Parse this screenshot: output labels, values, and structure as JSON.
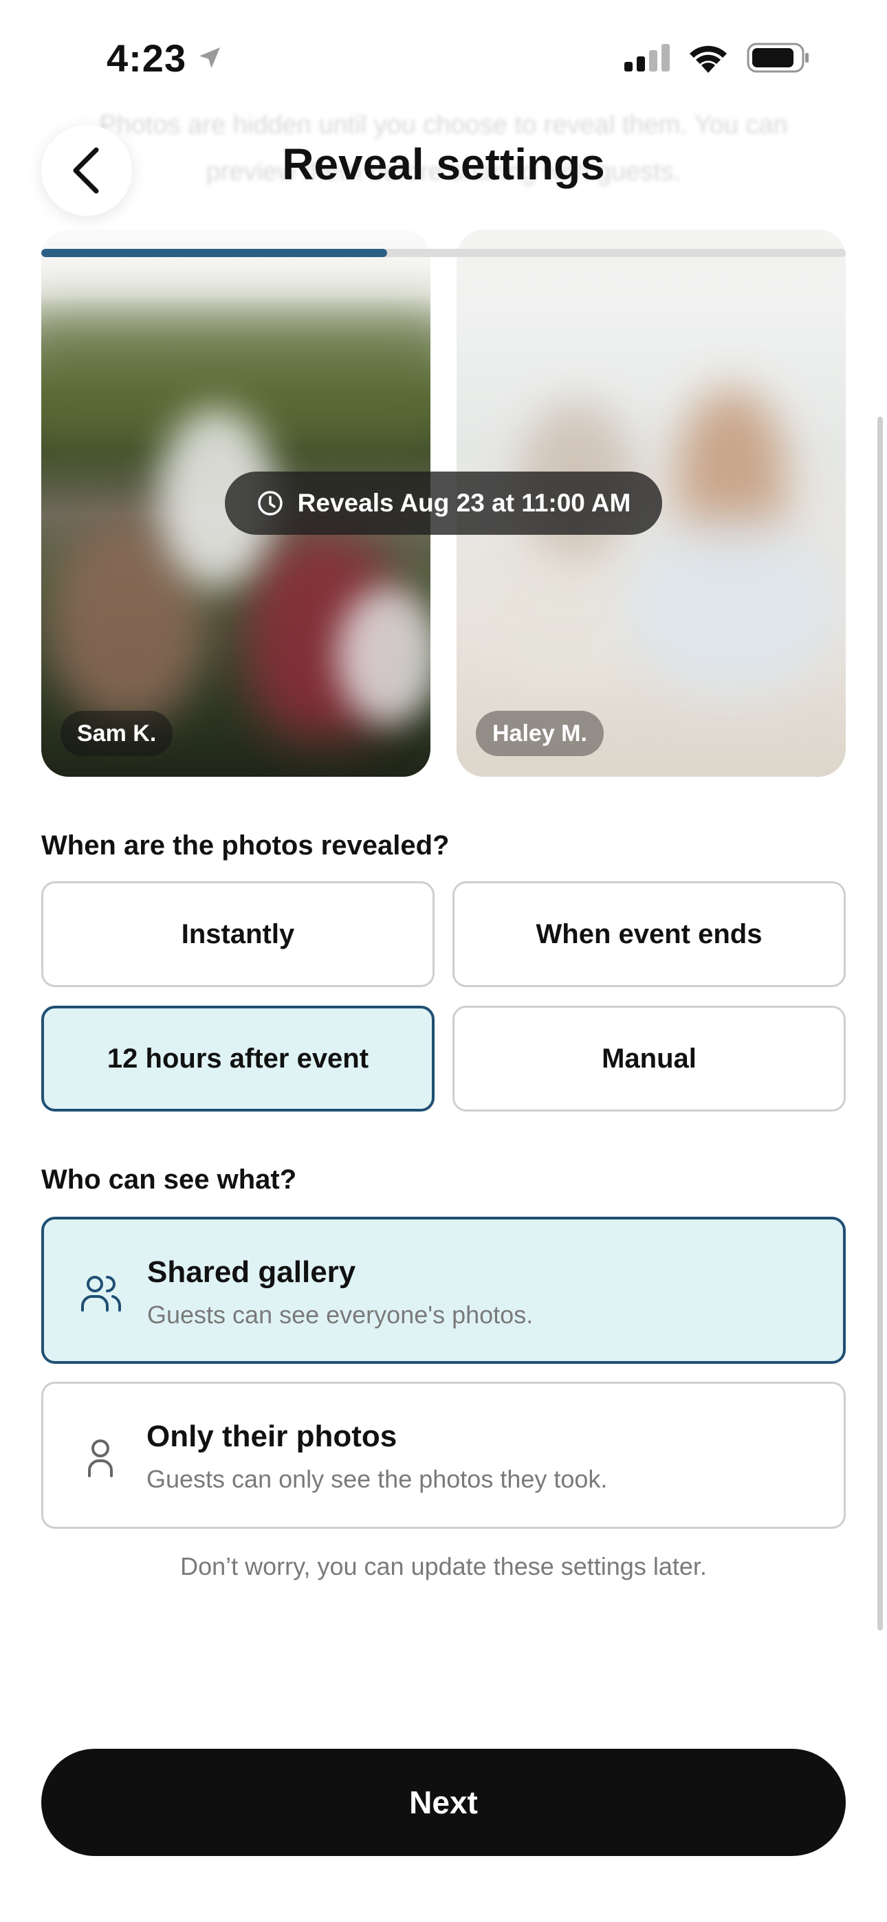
{
  "status_bar": {
    "time": "4:23"
  },
  "background_text": "Photos are hidden until you choose to reveal them. You can preview them before sharing with guests.",
  "header": {
    "title": "Reveal settings"
  },
  "progress": {
    "fraction": 0.43
  },
  "photos": [
    {
      "name": "Sam K."
    },
    {
      "name": "Haley M."
    }
  ],
  "reveal_badge": "Reveals Aug 23 at 11:00 AM",
  "reveal_section": {
    "heading": "When are the photos revealed?",
    "options": [
      "Instantly",
      "When event ends",
      "12 hours after event",
      "Manual"
    ],
    "selected": "12 hours after event"
  },
  "visibility_section": {
    "heading": "Who can see what?",
    "options": [
      {
        "title": "Shared gallery",
        "description": "Guests can see everyone's photos.",
        "icon": "users-icon"
      },
      {
        "title": "Only their photos",
        "description": "Guests can only see the photos they took.",
        "icon": "user-icon"
      }
    ],
    "selected": "Shared gallery"
  },
  "footnote": "Don’t worry, you can update these settings later.",
  "next_button": "Next",
  "colors": {
    "accent": "#1f4f73",
    "selected_bg": "#e0f3f4",
    "progress": "#2c5f86",
    "button_bg": "#0f0f0f"
  }
}
